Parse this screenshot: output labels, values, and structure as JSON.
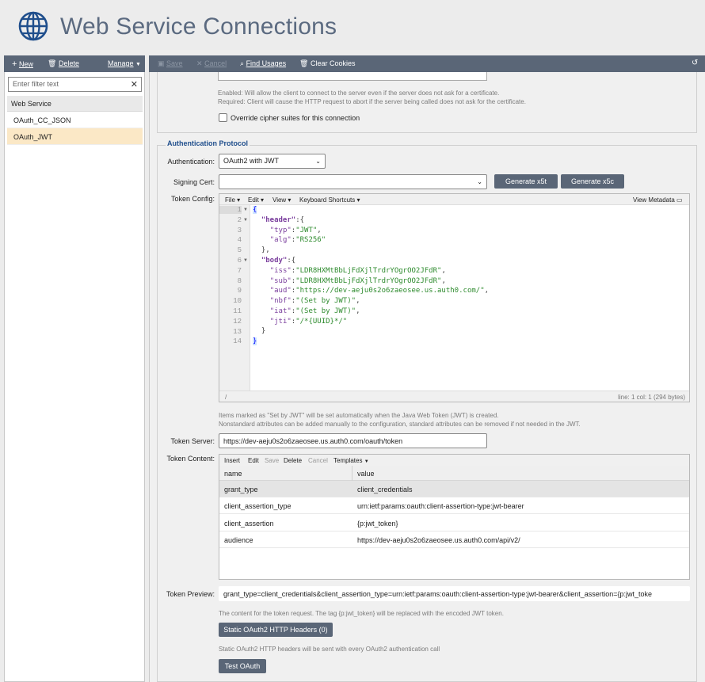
{
  "app": {
    "title": "Web Service Connections"
  },
  "left_toolbar": {
    "new": "New",
    "delete": "Delete",
    "manage": "Manage"
  },
  "filter": {
    "placeholder": "Enter filter text"
  },
  "list": {
    "header": "Web Service",
    "items": [
      {
        "label": "OAuth_CC_JSON",
        "selected": false
      },
      {
        "label": "OAuth_JWT",
        "selected": true
      }
    ]
  },
  "right_toolbar": {
    "save": "Save",
    "cancel": "Cancel",
    "find_usages": "Find Usages",
    "clear_cookies": "Clear Cookies"
  },
  "ssl": {
    "hint_line1": "Enabled: Will allow the client to connect to the server even if the server does not ask for a certificate.",
    "hint_line2": "Required: Client will cause the HTTP request to abort if the server being called does not ask for the certificate.",
    "cipher_label": "Override cipher suites for this connection",
    "cipher_checked": false
  },
  "auth": {
    "legend": "Authentication Protocol",
    "authentication_label": "Authentication:",
    "authentication_value": "OAuth2 with JWT",
    "signing_cert_label": "Signing Cert:",
    "signing_cert_value": "",
    "gen_x5t": "Generate x5t",
    "gen_x5c": "Generate x5c",
    "token_config_label": "Token Config:",
    "editor": {
      "menu": {
        "file": "File",
        "edit": "Edit",
        "view": "View",
        "shortcuts": "Keyboard Shortcuts",
        "metadata": "View Metadata"
      },
      "line_numbers": [
        "1",
        "2",
        "3",
        "4",
        "5",
        "6",
        "7",
        "8",
        "9",
        "10",
        "11",
        "12",
        "13",
        "14"
      ],
      "code": {
        "header_key": "\"header\"",
        "typ_key": "\"typ\"",
        "typ_val": "\"JWT\"",
        "alg_key": "\"alg\"",
        "alg_val": "\"RS256\"",
        "body_key": "\"body\"",
        "iss_key": "\"iss\"",
        "iss_val": "\"LDR8HXMtBbLjFdXjlTrdrYOgrOO2JFdR\"",
        "sub_key": "\"sub\"",
        "sub_val": "\"LDR8HXMtBbLjFdXjlTrdrYOgrOO2JFdR\"",
        "aud_key": "\"aud\"",
        "aud_val": "\"https://dev-aeju0s2o6zaeosee.us.auth0.com/\"",
        "nbf_key": "\"nbf\"",
        "nbf_val": "\"(Set by JWT)\"",
        "iat_key": "\"iat\"",
        "iat_val": "\"(Set by JWT)\"",
        "jti_key": "\"jti\"",
        "jti_val": "\"/*{UUID}*/\""
      },
      "status_left": "/",
      "status_right": "line: 1  col: 1  (294 bytes)"
    },
    "jwt_hint1": "Items marked as \"Set by JWT\" will be set automatically when the Java Web Token (JWT) is created.",
    "jwt_hint2": "Nonstandard attributes can be added manually to the configuration, standard attributes can be removed if not needed in the JWT.",
    "token_server_label": "Token Server:",
    "token_server_value": "https://dev-aeju0s2o6zaeosee.us.auth0.com/oauth/token",
    "token_content_label": "Token Content:",
    "grid": {
      "toolbar": {
        "insert": "Insert",
        "edit": "Edit",
        "save": "Save",
        "delete": "Delete",
        "cancel": "Cancel",
        "templates": "Templates"
      },
      "columns": [
        "name",
        "value"
      ],
      "rows": [
        {
          "name": "grant_type",
          "value": "client_credentials"
        },
        {
          "name": "client_assertion_type",
          "value": "urn:ietf:params:oauth:client-assertion-type:jwt-bearer"
        },
        {
          "name": "client_assertion",
          "value": "{p:jwt_token}"
        },
        {
          "name": "audience",
          "value": "https://dev-aeju0s2o6zaeosee.us.auth0.com/api/v2/"
        }
      ]
    },
    "token_preview_label": "Token Preview:",
    "token_preview_value": "grant_type=client_credentials&client_assertion_type=urn:ietf:params:oauth:client-assertion-type:jwt-bearer&client_assertion={p:jwt_toke",
    "preview_hint": "The content for the token request. The tag {p:jwt_token} will be replaced with the encoded JWT token.",
    "static_headers_btn": "Static OAuth2 HTTP Headers (0)",
    "static_headers_hint": "Static OAuth2 HTTP headers will be sent with every OAuth2 authentication call",
    "test_oauth_btn": "Test OAuth"
  },
  "colors": {
    "toolbar": "#5a6677",
    "selected_row": "#fbe8c6",
    "legend": "#1f4e8c",
    "title": "#5b6a80"
  }
}
